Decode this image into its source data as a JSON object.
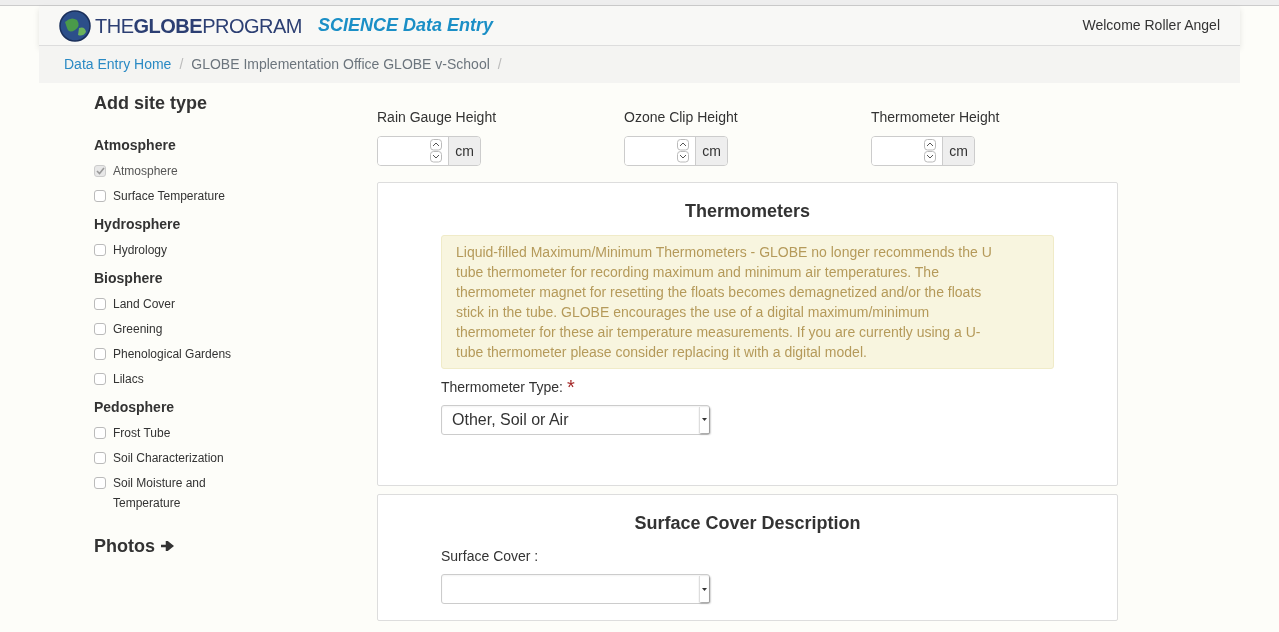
{
  "header": {
    "logo_text": "THE**GLOBE**PROGRAM",
    "app_title": "SCIENCE Data Entry",
    "welcome": "Welcome Roller Angel"
  },
  "breadcrumb": [
    {
      "label": "Data Entry Home",
      "link": true,
      "separator": "/"
    },
    {
      "label": "GLOBE Implementation Office GLOBE v-School",
      "link": false,
      "separator": "/"
    }
  ],
  "sidebar": {
    "title": "Add site type",
    "groups": [
      {
        "name": "Atmosphere",
        "items": [
          {
            "label": "Atmosphere",
            "checked": true,
            "disabled": true
          },
          {
            "label": "Surface Temperature",
            "checked": false,
            "disabled": false
          }
        ]
      },
      {
        "name": "Hydrosphere",
        "items": [
          {
            "label": "Hydrology",
            "checked": false,
            "disabled": false
          }
        ]
      },
      {
        "name": "Biosphere",
        "items": [
          {
            "label": "Land Cover",
            "checked": false,
            "disabled": false
          },
          {
            "label": "Greening",
            "checked": false,
            "disabled": false
          },
          {
            "label": "Phenological Gardens",
            "checked": false,
            "disabled": false
          },
          {
            "label": "Lilacs",
            "checked": false,
            "disabled": false
          }
        ]
      },
      {
        "name": "Pedosphere",
        "items": [
          {
            "label": "Frost Tube",
            "checked": false,
            "disabled": false
          },
          {
            "label": "Soil Characterization",
            "checked": false,
            "disabled": false
          },
          {
            "label": "Soil Moisture and Temperature",
            "checked": false,
            "disabled": false
          }
        ]
      }
    ],
    "photos_link": "Photos"
  },
  "heights": [
    {
      "label": "Rain Gauge Height",
      "unit": "cm"
    },
    {
      "label": "Ozone Clip Height",
      "unit": "cm"
    },
    {
      "label": "Thermometer Height",
      "unit": "cm"
    }
  ],
  "thermometers": {
    "title": "Thermometers",
    "notice": "Liquid-filled Maximum/Minimum Thermometers - GLOBE no longer recommends the U tube thermometer for recording maximum and minimum air temperatures. The thermometer magnet for resetting the floats becomes demagnetized and/or the floats stick in the tube. GLOBE encourages the use of a digital maximum/minimum thermometer for these air temperature measurements. If you are currently using a U-tube thermometer please consider replacing it with a digital model.",
    "type_label": "Thermometer Type:",
    "required_mark": "*",
    "type_value": "Other, Soil or Air"
  },
  "surface_cover": {
    "title": "Surface Cover Description",
    "label": "Surface Cover :"
  }
}
